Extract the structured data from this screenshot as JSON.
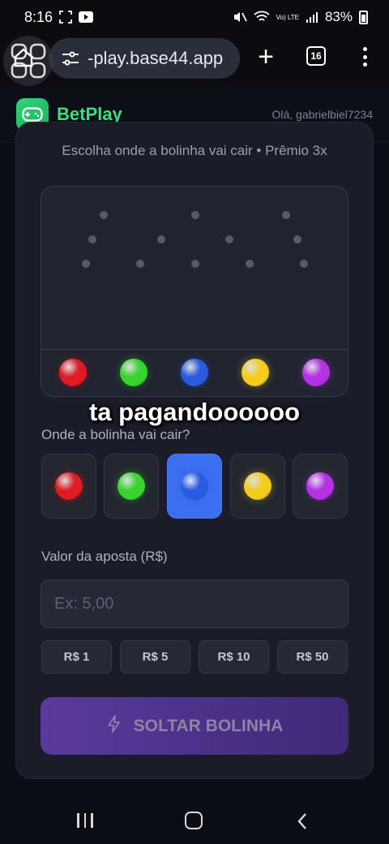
{
  "status_bar": {
    "time": "8:16",
    "battery": "83%",
    "network": "Vo) LTE"
  },
  "browser": {
    "url": "-play.base44.app",
    "tab_count": "16"
  },
  "header": {
    "brand": "BetPlay",
    "greeting": "Olá, gabrielbiel7234"
  },
  "game": {
    "subtitle": "Escolha onde a bolinha vai cair • Prêmio 3x",
    "caption": "ta pagandoooooo",
    "slots": [
      {
        "color": "red",
        "hex": "#e01b24"
      },
      {
        "color": "green",
        "hex": "#38d430"
      },
      {
        "color": "blue",
        "hex": "#2a5ae0"
      },
      {
        "color": "yellow",
        "hex": "#f5cc1c"
      },
      {
        "color": "purple",
        "hex": "#b431e6"
      }
    ],
    "pick_label": "Onde a bolinha vai cair?",
    "selected_color": "blue",
    "bet_label": "Valor da aposta (R$)",
    "bet_placeholder": "Ex: 5,00",
    "bet_value": "",
    "quick_amounts": [
      "R$ 1",
      "R$ 5",
      "R$ 10",
      "R$ 50"
    ],
    "drop_button": "SOLTAR BOLINHA"
  },
  "colors": {
    "brand_green": "#3ddc84",
    "selected_blue": "#3b6ff0",
    "card_bg": "#1a1d28"
  }
}
